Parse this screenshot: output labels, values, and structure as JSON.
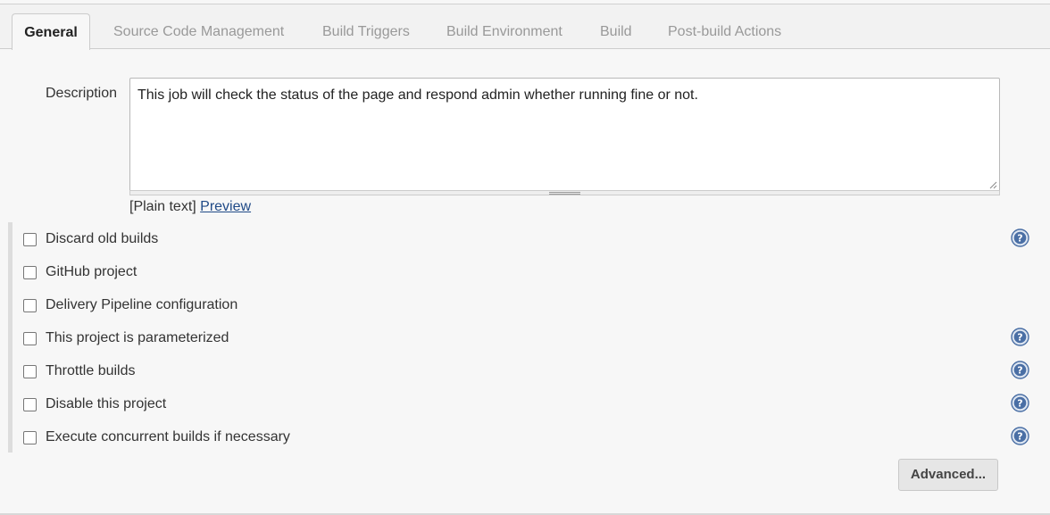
{
  "tabs": [
    {
      "label": "General",
      "active": true
    },
    {
      "label": "Source Code Management",
      "active": false
    },
    {
      "label": "Build Triggers",
      "active": false
    },
    {
      "label": "Build Environment",
      "active": false
    },
    {
      "label": "Build",
      "active": false
    },
    {
      "label": "Post-build Actions",
      "active": false
    }
  ],
  "description": {
    "label": "Description",
    "value": "This job will check the status of the page and respond admin whether running fine or not.",
    "markup_prefix": "[Plain text]",
    "preview_link": "Preview"
  },
  "options": [
    {
      "label": "Discard old builds",
      "checked": false,
      "help": true
    },
    {
      "label": "GitHub project",
      "checked": false,
      "help": false
    },
    {
      "label": "Delivery Pipeline configuration",
      "checked": false,
      "help": false
    },
    {
      "label": "This project is parameterized",
      "checked": false,
      "help": true
    },
    {
      "label": "Throttle builds",
      "checked": false,
      "help": true
    },
    {
      "label": "Disable this project",
      "checked": false,
      "help": true
    },
    {
      "label": "Execute concurrent builds if necessary",
      "checked": false,
      "help": true
    }
  ],
  "advanced_button": "Advanced...",
  "colors": {
    "help_icon": "#4a6fa5",
    "link": "#204a87",
    "background": "#f7f7f7"
  },
  "icons": {
    "help": "help-circle-icon",
    "resize": "resize-grip-icon"
  }
}
